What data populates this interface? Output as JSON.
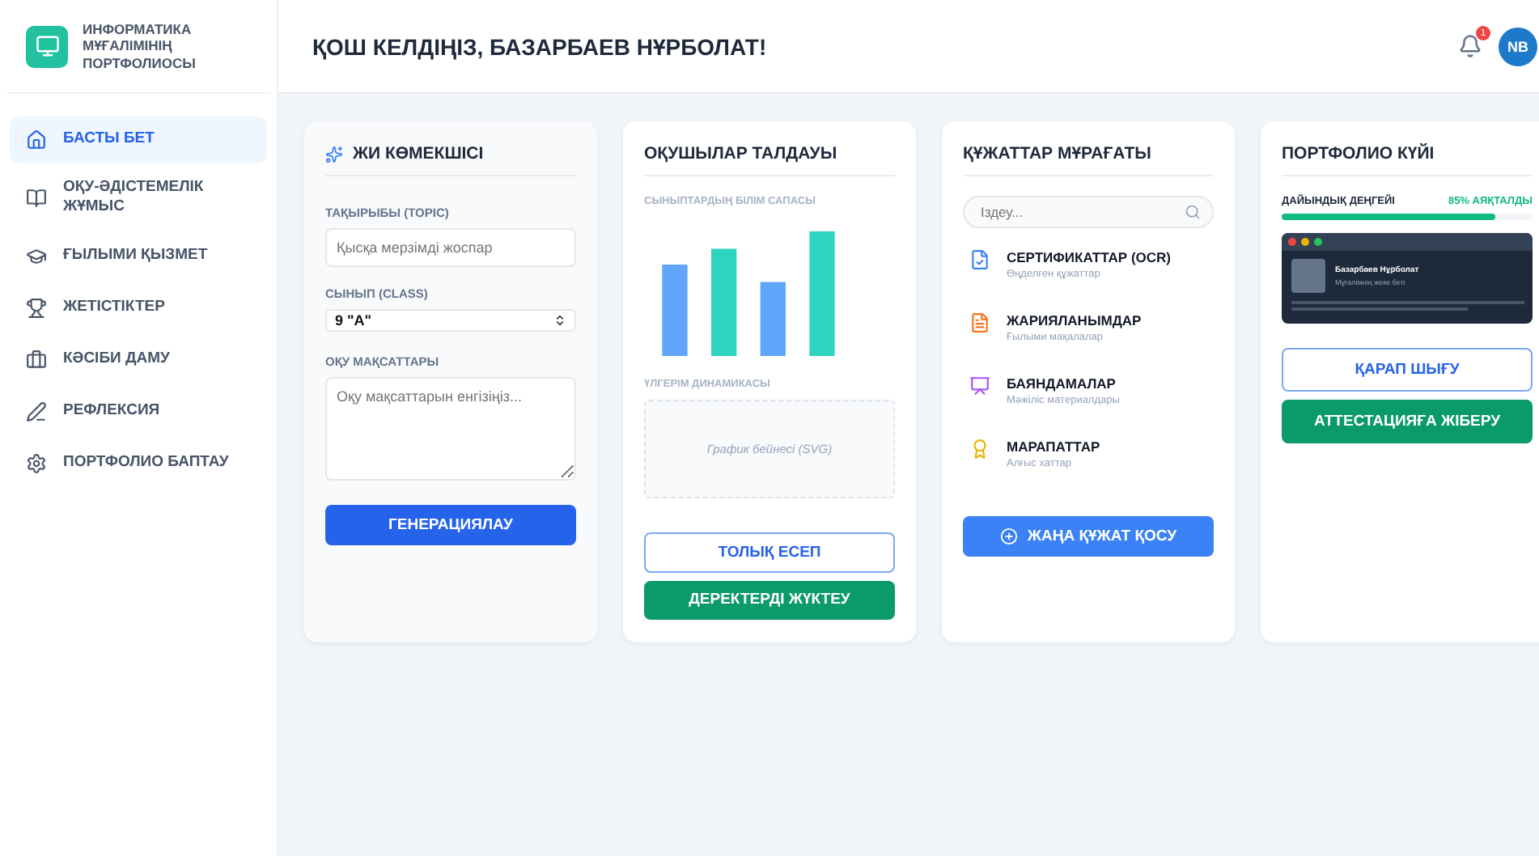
{
  "brand": {
    "title": "ИНФОРМАТИКА МҰҒАЛІМІНІҢ ПОРТФОЛИОСЫ"
  },
  "sidebar": {
    "items": [
      {
        "label": "БАСТЫ БЕТ",
        "selected": true
      },
      {
        "label": "ОҚУ-ӘДІСТЕМЕЛІК ЖҰМЫС",
        "selected": false
      },
      {
        "label": "ҒЫЛЫМИ ҚЫЗМЕТ",
        "selected": false
      },
      {
        "label": "ЖЕТІСТІКТЕР",
        "selected": false
      },
      {
        "label": "КӘСІБИ ДАМУ",
        "selected": false
      },
      {
        "label": "РЕФЛЕКСИЯ",
        "selected": false
      },
      {
        "label": "ПОРТФОЛИО БАПТАУ",
        "selected": false
      }
    ]
  },
  "header": {
    "title": "ҚОШ КЕЛДІҢІЗ, БАЗАРБАЕВ НҰРБОЛАТ!",
    "notifications": "1",
    "avatar": "NB"
  },
  "assistant": {
    "title": "ЖИ КӨМЕКШІСІ",
    "topic_label": "ТАҚЫРЫБЫ (TOPIC)",
    "topic_placeholder": "Қысқа мерзімді жоспар",
    "class_label": "СЫНЫП (CLASS)",
    "class_value": "9 \"А\"",
    "goals_label": "ОҚУ МАҚСАТТАРЫ",
    "goals_placeholder": "Оқу мақсаттарын енгізіңіз...",
    "button": "ГЕНЕРАЦИЯЛАУ"
  },
  "analysis": {
    "title": "ОҚУШЫЛАР ТАЛДАУЫ",
    "quality_label": "СЫНЫПТАРДЫҢ БІЛІМ САПАСЫ",
    "dynamics_label": "ҮЛГЕРІМ ДИНАМИКАСЫ",
    "placeholder": "График бейнесі (SVG)",
    "buttons": [
      {
        "label": "ТОЛЫҚ ЕСЕП",
        "kind": "outline"
      },
      {
        "label": "ДЕРЕКТЕРДІ ЖҮКТЕУ",
        "kind": "green"
      }
    ]
  },
  "archive": {
    "title": "ҚҰЖАТТАР МҰРАҒАТЫ",
    "search_placeholder": "Іздеу...",
    "items": [
      {
        "name": "СЕРТИФИКАТТАР (OCR)",
        "sub": "Өңделген құжаттар",
        "color": "#3b82f6"
      },
      {
        "name": "ЖАРИЯЛАНЫМДАР",
        "sub": "Ғылыми мақалалар",
        "color": "#f97316"
      },
      {
        "name": "БАЯНДАМАЛАР",
        "sub": "Мәжіліс материалдары",
        "color": "#a855f7"
      },
      {
        "name": "МАРАПАТТАР",
        "sub": "Алғыс хаттар",
        "color": "#eab308"
      }
    ],
    "button": "ЖАҢА ҚҰЖАТ ҚОСУ"
  },
  "portfolio": {
    "title": "ПОРТФОЛИО КҮЙІ",
    "readiness_label": "ДАЙЫНДЫҚ ДЕҢГЕЙІ",
    "readiness_reading": "85% АЯҚТАЛДЫ",
    "level": 0.85,
    "preview_name": "Базарбаев Нұрболат",
    "preview_sub": "Мұғалімнің жеке беті",
    "buttons": [
      {
        "label": "ҚАРАП ШЫҒУ",
        "kind": "outline"
      },
      {
        "label": "АТТЕСТАЦИЯҒА ЖІБЕРУ",
        "kind": "green"
      }
    ]
  }
}
